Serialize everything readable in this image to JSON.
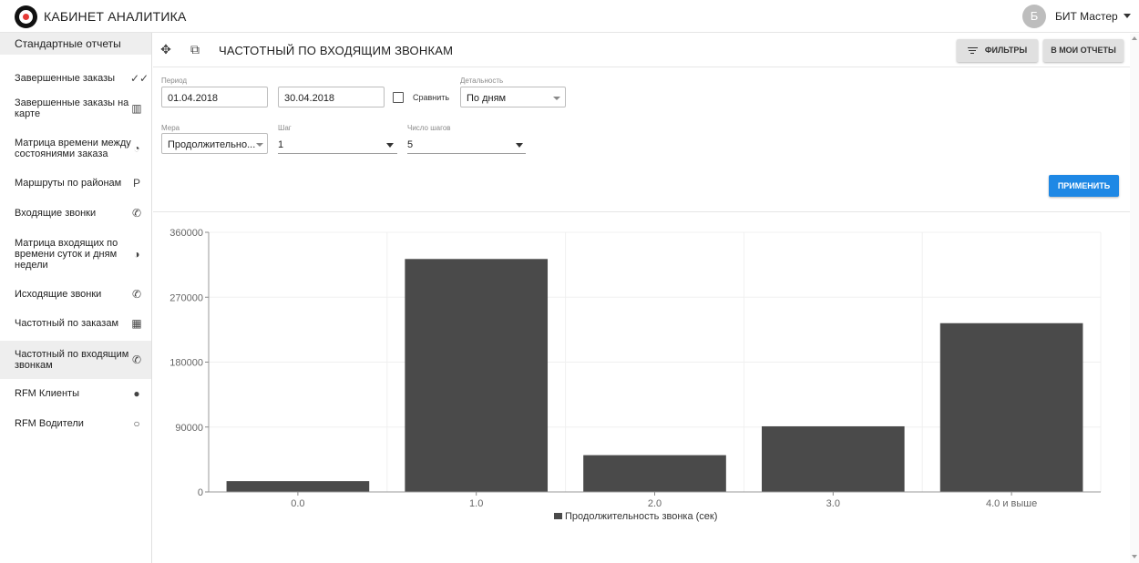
{
  "app": {
    "title": "КАБИНЕТ АНАЛИТИКА",
    "user_initial": "Б",
    "user_name": "БИТ Мастер"
  },
  "sidebar": {
    "header": "Стандартные отчеты",
    "items": [
      {
        "label": "Завершенные заказы",
        "icon": "double-check-icon",
        "glyph": "✓✓"
      },
      {
        "label": "Завершенные заказы на карте",
        "icon": "map-icon",
        "glyph": "▥"
      },
      {
        "label": "Матрица времени между состояниями заказа",
        "icon": "timelapse-icon",
        "glyph": "◔"
      },
      {
        "label": "Маршруты по районам",
        "icon": "parking-icon",
        "glyph": "P"
      },
      {
        "label": "Входящие звонки",
        "icon": "phone-incoming-icon",
        "glyph": "✆"
      },
      {
        "label": "Матрица входящих по времени суток и дням недели",
        "icon": "brightness-icon",
        "glyph": "◑"
      },
      {
        "label": "Исходящие звонки",
        "icon": "phone-outgoing-icon",
        "glyph": "✆"
      },
      {
        "label": "Частотный по заказам",
        "icon": "bar-chart-icon",
        "glyph": "▦"
      },
      {
        "label": "Частотный по входящим звонкам",
        "icon": "phone-in-talk-icon",
        "glyph": "✆",
        "active": true
      },
      {
        "label": "RFM Клиенты",
        "icon": "person-icon",
        "glyph": "●"
      },
      {
        "label": "RFM Водители",
        "icon": "person-outline-icon",
        "glyph": "○"
      }
    ]
  },
  "report": {
    "title": "ЧАСТОТНЫЙ ПО ВХОДЯЩИМ ЗВОНКАМ",
    "filters_button": "ФИЛЬТРЫ",
    "my_reports_button": "В МОИ ОТЧЕТЫ",
    "apply_button": "ПРИМЕНИТЬ"
  },
  "form": {
    "period_label": "Период",
    "date_from": "01.04.2018",
    "date_to": "30.04.2018",
    "compare_label": "Сравнить",
    "compare_checked": false,
    "detail_label": "Детальность",
    "detail_value": "По дням",
    "measure_label": "Мера",
    "measure_value": "Продолжительно...",
    "step_label": "Шаг",
    "step_value": "1",
    "steps_count_label": "Число шагов",
    "steps_count_value": "5"
  },
  "chart_data": {
    "type": "bar",
    "categories": [
      "0.0",
      "1.0",
      "2.0",
      "3.0",
      "4.0 и выше"
    ],
    "series": [
      {
        "name": "Продолжительность звонка (сек)",
        "values": [
          15000,
          323000,
          51000,
          91000,
          234000
        ],
        "color": "#4a4a4a"
      }
    ],
    "yticks": [
      0,
      90000,
      180000,
      270000,
      360000
    ],
    "ylim": [
      0,
      360000
    ],
    "grid": true,
    "legend": "bottom"
  }
}
